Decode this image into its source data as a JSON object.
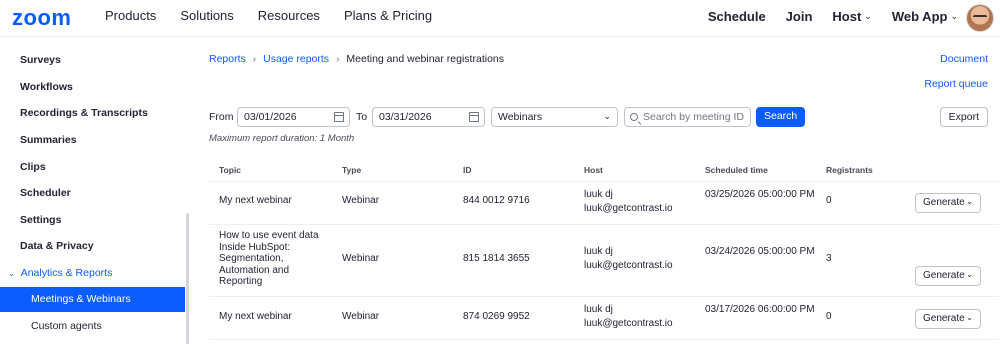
{
  "brand": {
    "logo": "zoom",
    "accent": "#0b5cff"
  },
  "topnav": {
    "left": [
      "Products",
      "Solutions",
      "Resources",
      "Plans & Pricing"
    ],
    "right": [
      "Schedule",
      "Join",
      "Host",
      "Web App"
    ]
  },
  "sidebar": {
    "items": [
      "Surveys",
      "Workflows",
      "Recordings & Transcripts",
      "Summaries",
      "Clips",
      "Scheduler",
      "Settings",
      "Data & Privacy"
    ],
    "section": "Analytics & Reports",
    "active": "Meetings & Webinars",
    "sub_items": [
      "Custom agents"
    ]
  },
  "breadcrumb": [
    "Reports",
    "Usage reports",
    "Meeting and webinar registrations"
  ],
  "links": {
    "document": "Document",
    "report_queue": "Report queue"
  },
  "filters": {
    "from_label": "From",
    "from_value": "03/01/2026",
    "to_label": "To",
    "to_value": "03/31/2026",
    "type_value": "Webinars",
    "search_placeholder": "Search by meeting ID",
    "search_button": "Search",
    "export_button": "Export",
    "max_note": "Maximum report duration: 1 Month"
  },
  "table": {
    "headers": [
      "Topic",
      "Type",
      "ID",
      "Host",
      "Scheduled time",
      "Registrants"
    ],
    "rows": [
      {
        "topic": "My next webinar",
        "type": "Webinar",
        "id": "844 0012 9716",
        "host_name": "luuk dj",
        "host_email": "luuk@getcontrast.io",
        "time": "03/25/2026 05:00:00 PM",
        "registrants": "0",
        "action": "Generate"
      },
      {
        "topic": "How to use event data Inside HubSpot: Segmentation, Automation and Reporting",
        "type": "Webinar",
        "id": "815 1814 3655",
        "host_name": "luuk dj",
        "host_email": "luuk@getcontrast.io",
        "time": "03/24/2026 05:00:00 PM",
        "registrants": "3",
        "action": "Generate"
      },
      {
        "topic": "My next webinar",
        "type": "Webinar",
        "id": "874 0269 9952",
        "host_name": "luuk dj",
        "host_email": "luuk@getcontrast.io",
        "time": "03/17/2026 06:00:00 PM",
        "registrants": "0",
        "action": "Generate"
      }
    ]
  }
}
